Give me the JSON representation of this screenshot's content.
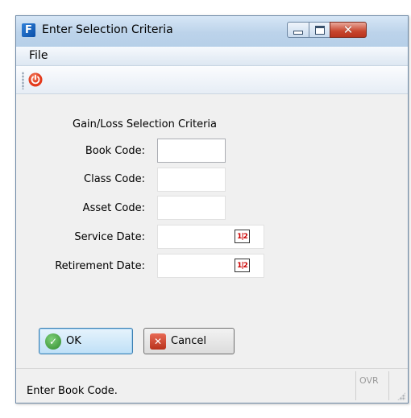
{
  "window": {
    "title": "Enter Selection Criteria",
    "app_icon_glyph": "F",
    "controls": {
      "minimize": "minimize-icon",
      "maximize": "maximize-icon",
      "close": "close-icon"
    }
  },
  "menu": {
    "file": "File"
  },
  "toolbar": {
    "power_icon": "power-icon",
    "power_color": "#e8391a"
  },
  "form": {
    "heading": "Gain/Loss Selection Criteria",
    "book_code_label": "Book Code:",
    "book_code_value": "",
    "class_code_label": "Class Code:",
    "class_code_value": "",
    "asset_code_label": "Asset Code:",
    "asset_code_value": "",
    "service_date_label": "Service Date:",
    "service_date_value": "",
    "retirement_date_label": "Retirement Date:",
    "retirement_date_value": "",
    "calendar_glyph": "1|2"
  },
  "buttons": {
    "ok": "OK",
    "cancel": "Cancel"
  },
  "status": {
    "message": "Enter Book Code.",
    "mode": "OVR"
  }
}
